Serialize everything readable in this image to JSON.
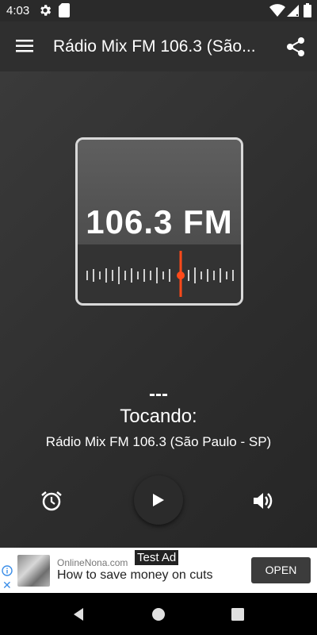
{
  "status_bar": {
    "time": "4:03"
  },
  "app_bar": {
    "title": "Rádio Mix FM 106.3 (São..."
  },
  "radio": {
    "frequency": "106.3 FM"
  },
  "player": {
    "track": "---",
    "playing_label": "Tocando:",
    "station_name": "Rádio Mix FM 106.3 (São Paulo - SP)"
  },
  "ad": {
    "source": "OnlineNona.com",
    "tag": "Test Ad",
    "headline": "How to save money on cuts",
    "cta": "OPEN"
  },
  "colors": {
    "accent": "#ff4a1a",
    "background": "#2f2f2f"
  }
}
